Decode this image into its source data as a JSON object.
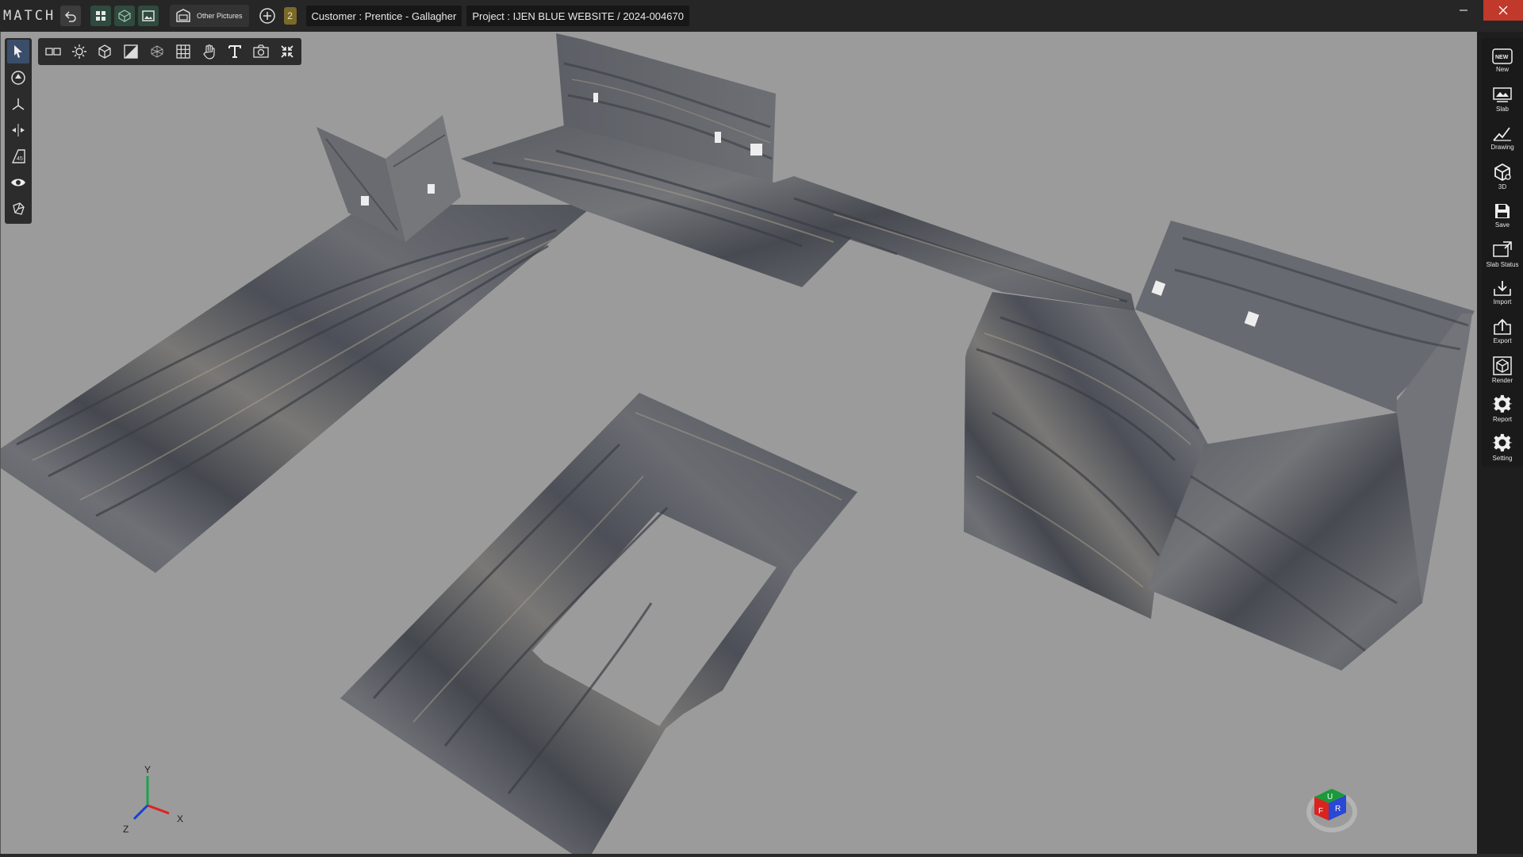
{
  "app": {
    "logo": "MATCH",
    "toolbar": {
      "other_pictures_label": "Other Pictures",
      "notification_count": "2"
    },
    "customer_label": "Customer : Prentice - Gallagher",
    "project_label": "Project : IJEN BLUE WEBSITE / 2024-004670"
  },
  "right_panel": {
    "items": [
      {
        "label": "New",
        "icon": "new-icon"
      },
      {
        "label": "Slab",
        "icon": "slab-icon"
      },
      {
        "label": "Drawing",
        "icon": "drawing-icon"
      },
      {
        "label": "3D",
        "icon": "3d-cube-icon"
      },
      {
        "label": "Save",
        "icon": "save-icon"
      },
      {
        "label": "Slab Status",
        "icon": "slab-status-icon"
      },
      {
        "label": "Import",
        "icon": "import-icon"
      },
      {
        "label": "Export",
        "icon": "export-icon"
      },
      {
        "label": "Render",
        "icon": "render-icon"
      },
      {
        "label": "Report",
        "icon": "report-gear-icon"
      },
      {
        "label": "Setting",
        "icon": "setting-gear-icon"
      }
    ],
    "new_badge": "NEW"
  },
  "left_tools": [
    "select-arrow-icon",
    "orbit-icon",
    "axis-move-icon",
    "split-icon",
    "angle-45-icon",
    "eye-icon",
    "shape-icon"
  ],
  "top_tools": [
    "dual-view-icon",
    "light-icon",
    "box-icon",
    "shade-icon",
    "wireframe-icon",
    "grid-icon",
    "pan-hand-icon",
    "text-icon",
    "camera-icon",
    "collapse-icon"
  ],
  "axis": {
    "x": "X",
    "y": "Y",
    "z": "Z"
  },
  "view_cube": {
    "top": "U",
    "front": "F",
    "right": "R"
  },
  "colors": {
    "viewport_bg": "#9b9b9b",
    "marble_base": "#5d6066",
    "accent_blue": "#3a4e6a"
  }
}
